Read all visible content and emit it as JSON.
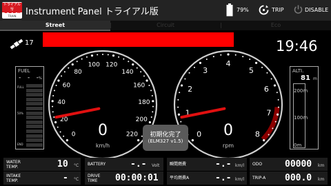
{
  "header": {
    "logo_tag": "トライアル版",
    "logo_main": "OBDⅡ",
    "logo_sub": "TRAIN",
    "title": "Instrument Panel トライアル版",
    "battery_percent": "79%",
    "trip_label": "TRIP",
    "disable_label": "DISABLE"
  },
  "tabs": [
    {
      "label": "Street",
      "active": true
    },
    {
      "label": "Circuit",
      "active": false
    },
    {
      "label": "Eco",
      "active": false
    }
  ],
  "status": {
    "satellite_count": "17",
    "alert_color": "#ff0000",
    "clock": "19:46"
  },
  "fuel": {
    "title": "FUEL",
    "value": "- - -",
    "unit": "%",
    "full_label": "FULL",
    "half_label": "50%",
    "end_label": "END",
    "level_percent": 0
  },
  "altimeter": {
    "title": "ALTI.",
    "value": "81",
    "unit": "m",
    "scale_top": "200m",
    "scale_mid": "100m",
    "scale_bottom": "0m",
    "level": 0.405
  },
  "speedometer": {
    "ticks": [
      "0",
      "20",
      "40",
      "60",
      "80",
      "100",
      "120",
      "140",
      "160",
      "180",
      "200",
      "220"
    ],
    "value": "0",
    "unit": "km/h",
    "needle_color": "#e01010"
  },
  "tachometer": {
    "ticks": [
      "0",
      "1",
      "2",
      "3",
      "4",
      "5",
      "6",
      "7",
      "8"
    ],
    "value": "0",
    "unit": "rpm",
    "redline_color": "#8b0000",
    "needle_color": "#e01010"
  },
  "toast": {
    "line1": "初期化完了",
    "line2": "(ELM327 v1.5)"
  },
  "readouts": {
    "water_temp": {
      "label": "WATER\nTEMP.",
      "value": "10",
      "unit": "°C"
    },
    "intake_temp": {
      "label": "INTAKE\nTEMP.",
      "value": "-",
      "unit": "°C"
    },
    "battery": {
      "label": "BATTERY",
      "value": "-.-",
      "unit": "Volt"
    },
    "drive_time": {
      "label": "DRIVE\nTIME",
      "value": "00:00:01",
      "unit": ""
    },
    "instant_fuel": {
      "label": "瞬間燃費",
      "value": "-.-",
      "unit": "km/l"
    },
    "avg_fuel": {
      "label": "平均燃費A",
      "value": "-.-",
      "unit": "km/l"
    },
    "odo": {
      "label": "ODO",
      "value": "00000",
      "unit": "km"
    },
    "trip_a": {
      "label": "TRIP-A",
      "value": "000.0",
      "unit": "km"
    }
  }
}
